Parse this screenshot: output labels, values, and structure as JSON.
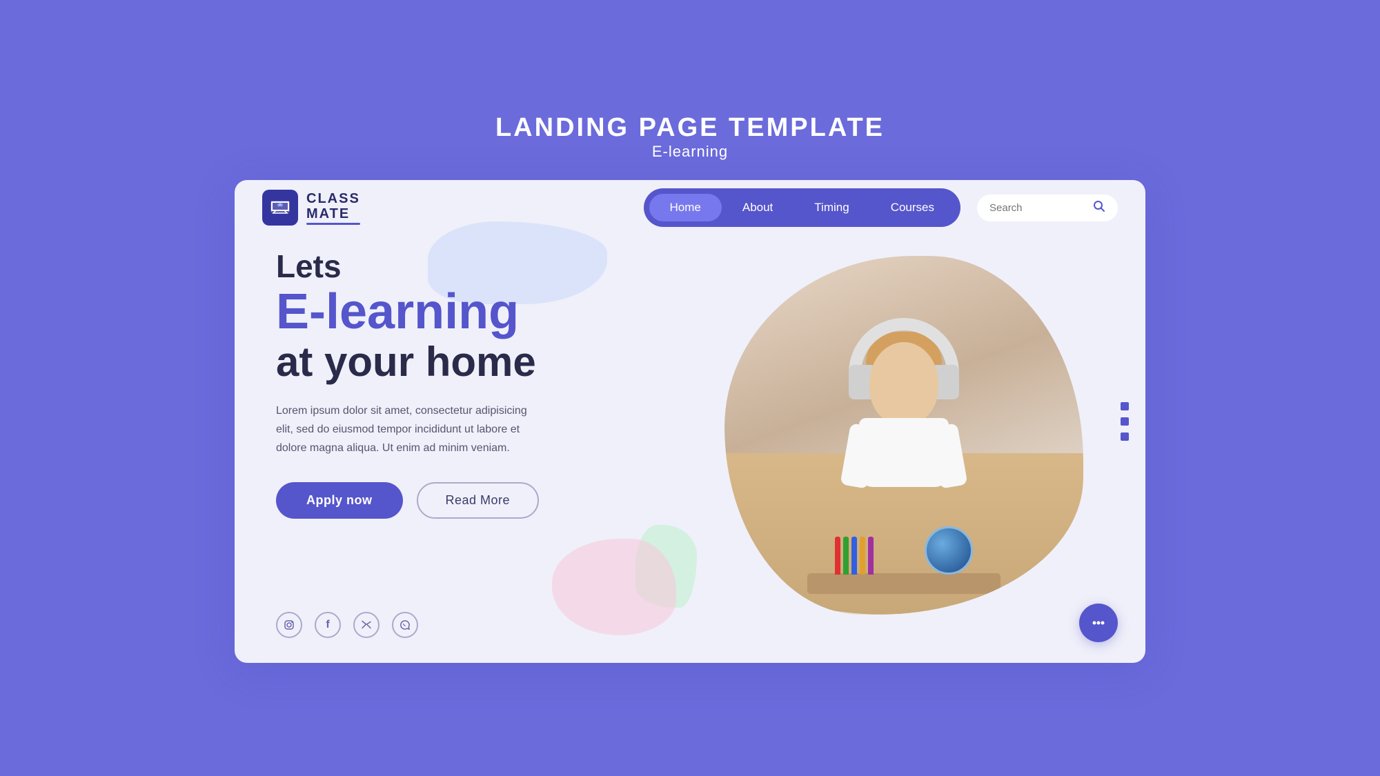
{
  "meta": {
    "page_title": "LANDING PAGE TEMPLATE",
    "page_subtitle": "E-learning"
  },
  "logo": {
    "class_text": "CLASS",
    "mate_text": "MATE"
  },
  "nav": {
    "items": [
      {
        "label": "Home",
        "active": true
      },
      {
        "label": "About",
        "active": false
      },
      {
        "label": "Timing",
        "active": false
      },
      {
        "label": "Courses",
        "active": false
      }
    ],
    "search_placeholder": "Search"
  },
  "hero": {
    "line1": "Lets",
    "line2": "E-learning",
    "line3": "at your home",
    "description": "Lorem ipsum dolor sit amet, consectetur adipisicing elit, sed do eiusmod tempor incididunt ut labore et dolore magna aliqua. Ut enim ad minim veniam.",
    "btn_apply": "Apply now",
    "btn_read": "Read More"
  },
  "social": {
    "icons": [
      {
        "name": "instagram-icon",
        "symbol": "◎"
      },
      {
        "name": "facebook-icon",
        "symbol": "f"
      },
      {
        "name": "twitter-icon",
        "symbol": "𝕏"
      },
      {
        "name": "whatsapp-icon",
        "symbol": "✆"
      }
    ]
  },
  "chat": {
    "icon_label": "chat-icon"
  },
  "colors": {
    "primary": "#5555cc",
    "text_dark": "#2a2a4a",
    "text_muted": "#555570",
    "background": "#f0f0fa",
    "outer_bg": "#6b6bdc"
  }
}
